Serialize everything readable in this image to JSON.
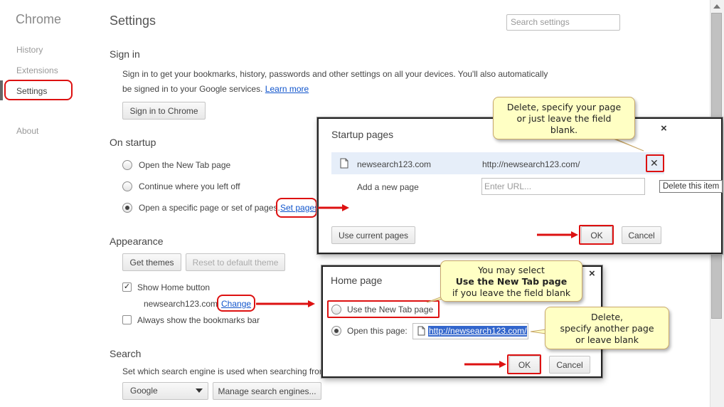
{
  "sidebar": {
    "brand": "Chrome",
    "items": [
      {
        "label": "History"
      },
      {
        "label": "Extensions"
      },
      {
        "label": "Settings"
      },
      {
        "label": "About"
      }
    ]
  },
  "header": {
    "title": "Settings",
    "search_placeholder": "Search settings"
  },
  "sign_in": {
    "title": "Sign in",
    "line1": "Sign in to get your bookmarks, history, passwords and other settings on all your devices. You'll also automatically",
    "line2": "be signed in to your Google services.",
    "learn_more": "Learn more",
    "button": "Sign in to Chrome"
  },
  "startup": {
    "title": "On startup",
    "options": [
      "Open the New Tab page",
      "Continue where you left off",
      "Open a specific page or set of pages."
    ],
    "selected_index": 2,
    "set_pages": "Set pages"
  },
  "appearance": {
    "title": "Appearance",
    "get_themes": "Get themes",
    "reset_theme": "Reset to default theme",
    "show_home": "Show Home button",
    "home_url": "newsearch123.com",
    "change": "Change",
    "bookmarks_bar": "Always show the bookmarks bar"
  },
  "search_section": {
    "title": "Search",
    "desc": "Set which search engine is used when searching from",
    "engine": "Google",
    "manage": "Manage search engines..."
  },
  "startup_dialog": {
    "title": "Startup pages",
    "close": "×",
    "page_name": "newsearch123.com",
    "page_url": "http://newsearch123.com/",
    "remove": "✕",
    "add_label": "Add a new page",
    "url_placeholder": "Enter URL...",
    "use_current": "Use current pages",
    "ok": "OK",
    "cancel": "Cancel",
    "tooltip": "Delete this item"
  },
  "home_dialog": {
    "title": "Home page",
    "close": "×",
    "opt_newtab": "Use the New Tab page",
    "opt_open": "Open this page:",
    "url_value": "http://newsearch123.com/",
    "ok": "OK",
    "cancel": "Cancel"
  },
  "callouts": {
    "delete_specify": [
      "Delete, specify your page",
      "or just leave the field",
      "blank."
    ],
    "may_select": [
      "You may select",
      "Use the New Tab page",
      "if you leave the field blank"
    ],
    "delete_another": [
      "Delete,",
      "specify another page",
      "or leave blank"
    ]
  },
  "colors": {
    "annotation_red": "#dd1111",
    "link": "#1155cc",
    "callout_bg": "#ffffc4",
    "selection": "#3366cc"
  }
}
